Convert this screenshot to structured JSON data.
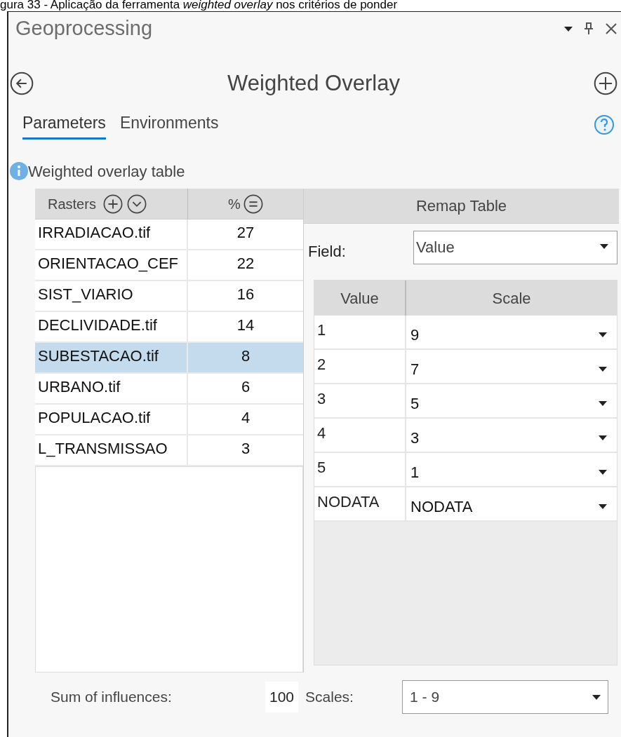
{
  "caption": "gura 33 - Aplicação da ferramenta *weighted overlay* nos critérios de ponder",
  "window": {
    "title": "Geoprocessing"
  },
  "tool": {
    "title": "Weighted Overlay"
  },
  "tabs": [
    {
      "label": "Parameters",
      "selected": true
    },
    {
      "label": "Environments",
      "selected": false
    }
  ],
  "parameter": {
    "label": "Weighted overlay table"
  },
  "rasters_table": {
    "columns": [
      "Rasters",
      "%"
    ],
    "rows": [
      {
        "raster": "IRRADIACAO.tif",
        "percent": "27",
        "selected": false
      },
      {
        "raster": "ORIENTACAO_CEF",
        "percent": "22",
        "selected": false
      },
      {
        "raster": "SIST_VIARIO",
        "percent": "16",
        "selected": false
      },
      {
        "raster": "DECLIVIDADE.tif",
        "percent": "14",
        "selected": false
      },
      {
        "raster": "SUBESTACAO.tif",
        "percent": "8",
        "selected": true
      },
      {
        "raster": "URBANO.tif",
        "percent": "6",
        "selected": false
      },
      {
        "raster": "POPULACAO.tif",
        "percent": "4",
        "selected": false
      },
      {
        "raster": "L_TRANSMISSAO",
        "percent": "3",
        "selected": false
      }
    ]
  },
  "remap_table": {
    "title": "Remap Table",
    "field_label": "Field:",
    "field_value": "Value",
    "columns": [
      "Value",
      "Scale"
    ],
    "rows": [
      {
        "value": "1",
        "scale": "9"
      },
      {
        "value": "2",
        "scale": "7"
      },
      {
        "value": "3",
        "scale": "5"
      },
      {
        "value": "4",
        "scale": "3"
      },
      {
        "value": "5",
        "scale": "1"
      },
      {
        "value": "NODATA",
        "scale": "NODATA"
      }
    ]
  },
  "footer": {
    "sum_label": "Sum of influences:",
    "sum_value": "100",
    "scales_label": "Scales:",
    "scales_value": "1 - 9"
  }
}
